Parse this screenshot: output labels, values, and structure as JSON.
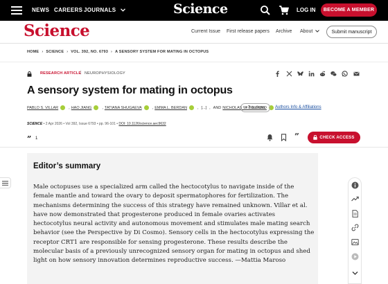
{
  "topbar": {
    "nav": [
      "NEWS",
      "CAREERS",
      "JOURNALS"
    ],
    "brand": "Science",
    "login": "LOG IN",
    "member_button": "BECOME A MEMBER"
  },
  "header": {
    "brand": "Science",
    "nav": [
      "Current Issue",
      "First release papers",
      "Archive",
      "About"
    ],
    "submit_button": "Submit manuscript"
  },
  "breadcrumb": [
    "HOME",
    "SCIENCE",
    "VOL. 392, NO. 6793",
    "A SENSORY SYSTEM FOR MATING IN OCTOPUS"
  ],
  "article": {
    "type": "RESEARCH ARTICLE",
    "subject": "NEUROPHYSIOLOGY",
    "title": "A sensory system for mating in octopus",
    "authors": [
      "PABLO S. VILLAR",
      "HAO JIANG",
      "TATIANA SHUGAEVA",
      "EMMA L. BERDAN"
    ],
    "authors_ellipsis": "[...]",
    "authors_and": "AND",
    "last_author": "NICHOLAS W. BELLONO",
    "more_authors": "+7 authors",
    "affiliations": "Authors Info & Affiliations",
    "journal": "SCIENCE",
    "date": "2 Apr 2026",
    "volume": "Vol 392, Issue 6793",
    "pages": "pp. 96-101",
    "doi": "DOI: 10.1126/science.aec9632",
    "citations": "1",
    "check_access": "CHECK ACCESS"
  },
  "summary": {
    "heading": "Editor’s summary",
    "text": "Male octopuses use a specialized arm called the hectocotylus to navigate inside of the female mantle and toward the ovary to deposit spermatophores for fertilization. The mechanisms determining the success of this strategy have remained unknown. Villar et al. have now demonstrated that progesterone produced in female ovaries activates hectocotylus neural activity and autonomous movement and stimulates male mating search behavior (see the Perspective by Di Cosmo). Sensory cells in the hectocotylus expressing the receptor CRT1 are responsible for sensing progesterone. These results describe the molecular basis of a previously unrecognized sensory organ for mating in octopus and shed light on how sensory innovation determines reproductive success. —Mattia Maroso"
  },
  "colors": {
    "brand_red": "#c8102e",
    "topbar_bg": "#000000",
    "summary_bg": "#f3f3f3",
    "orcid_green": "#a6ce39"
  },
  "icons": {
    "topbar": [
      "menu-icon",
      "search-icon",
      "cart-icon"
    ],
    "share": [
      "facebook-icon",
      "x-icon",
      "bluesky-icon",
      "linkedin-icon",
      "reddit-icon",
      "wechat-icon",
      "whatsapp-icon",
      "email-icon"
    ],
    "actions": [
      "bell-icon",
      "bookmark-icon",
      "quote-icon",
      "lock-icon"
    ],
    "rail": [
      "info-icon",
      "trend-icon",
      "file-icon",
      "link-icon",
      "image-icon",
      "play-icon",
      "chevron-down-icon"
    ]
  }
}
